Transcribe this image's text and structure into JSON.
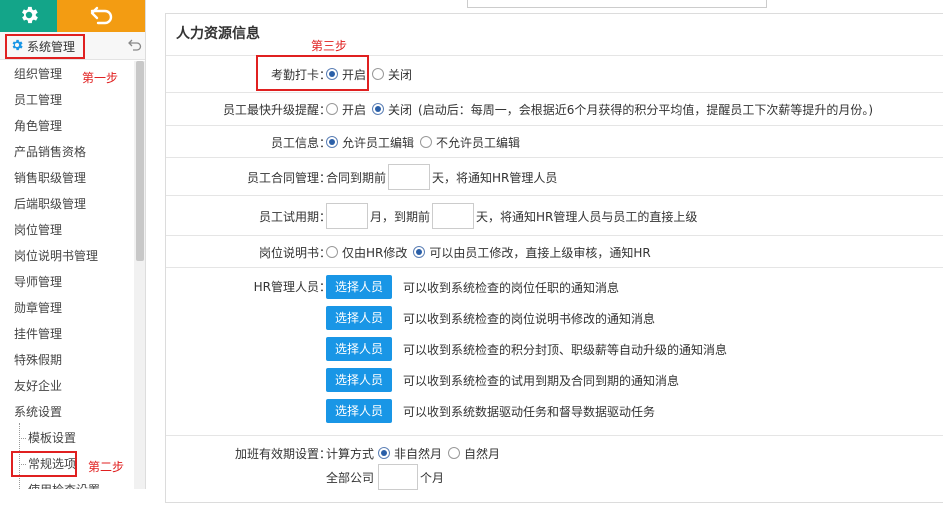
{
  "sidebar": {
    "header_label": "系统管理",
    "items": [
      {
        "label": "组织管理"
      },
      {
        "label": "员工管理"
      },
      {
        "label": "角色管理"
      },
      {
        "label": "产品销售资格"
      },
      {
        "label": "销售职级管理"
      },
      {
        "label": "后端职级管理"
      },
      {
        "label": "岗位管理"
      },
      {
        "label": "岗位说明书管理"
      },
      {
        "label": "导师管理"
      },
      {
        "label": "勋章管理"
      },
      {
        "label": "挂件管理"
      },
      {
        "label": "特殊假期"
      },
      {
        "label": "友好企业"
      },
      {
        "label": "系统设置"
      }
    ],
    "sub_items": [
      {
        "label": "模板设置"
      },
      {
        "label": "常规选项"
      },
      {
        "label": "使用检查设置"
      }
    ]
  },
  "annotations": {
    "step1": "第一步",
    "step2": "第二步",
    "step3": "第三步"
  },
  "content": {
    "section_title": "人力资源信息",
    "attendance": {
      "label": "考勤打卡：",
      "opt_on": "开启",
      "opt_off": "关闭",
      "selected": "on"
    },
    "promotion": {
      "label": "员工最快升级提醒：",
      "opt_on": "开启",
      "opt_off": "关闭",
      "selected": "off",
      "note": "(启动后：每周一，会根据近6个月获得的积分平均值，提醒员工下次薪等提升的月份。)"
    },
    "employee_info": {
      "label": "员工信息：",
      "opt_allow": "允许员工编辑",
      "opt_deny": "不允许员工编辑",
      "selected": "allow"
    },
    "contract": {
      "label": "员工合同管理：",
      "prefix": "合同到期前",
      "suffix": "天，将通知HR管理人员",
      "value": ""
    },
    "probation": {
      "label": "员工试用期：",
      "month_suffix": "月，到期前",
      "day_suffix": "天，将通知HR管理人员与员工的直接上级",
      "months": "",
      "days": ""
    },
    "job_desc": {
      "label": "岗位说明书：",
      "opt_hr": "仅由HR修改",
      "opt_emp": "可以由员工修改，直接上级审核，通知HR",
      "selected": "emp"
    },
    "hr_managers": {
      "label": "HR管理人员：",
      "button_label": "选择人员",
      "rows": [
        {
          "text": "可以收到系统检查的岗位任职的通知消息"
        },
        {
          "text": "可以收到系统检查的岗位说明书修改的通知消息"
        },
        {
          "text": "可以收到系统检查的积分封顶、职级薪等自动升级的通知消息"
        },
        {
          "text": "可以收到系统检查的试用到期及合同到期的通知消息"
        },
        {
          "text": "可以收到系统数据驱动任务和督导数据驱动任务"
        }
      ]
    },
    "overtime": {
      "label": "加班有效期设置：",
      "prefix": "计算方式",
      "opt_nonnatural": "非自然月",
      "opt_natural": "自然月",
      "selected": "nonnatural",
      "company_label": "全部公司",
      "month_suffix": "个月",
      "value": ""
    }
  },
  "colors": {
    "settings_btn": "#13a589",
    "back_btn": "#f39c12",
    "highlight_red": "#e02020",
    "select_button": "#1996e6"
  },
  "icons": [
    "gear-icon",
    "back-arrow-icon",
    "collapse-icon"
  ]
}
